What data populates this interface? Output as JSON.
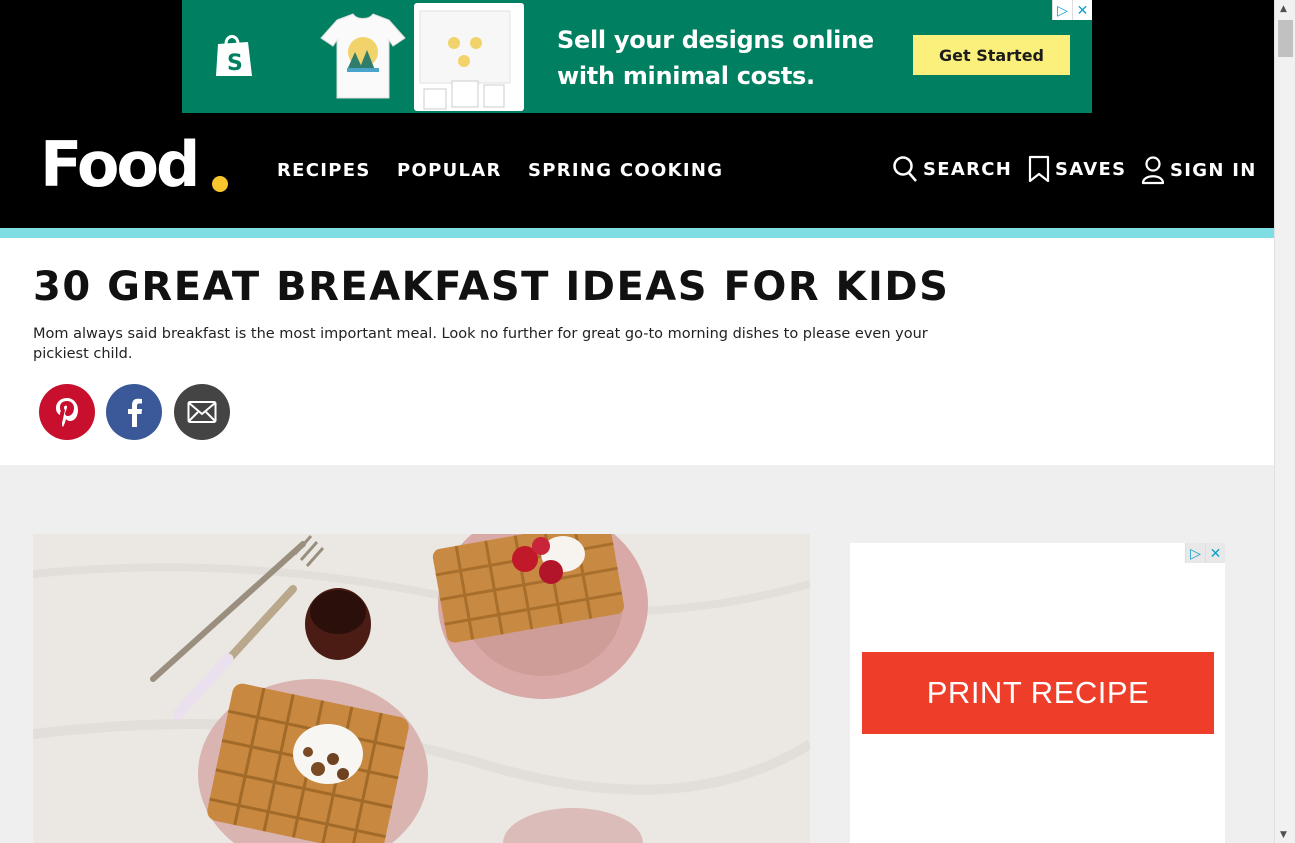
{
  "top_ad": {
    "headline_line1": "Sell your designs online",
    "headline_line2": "with minimal costs.",
    "cta": "Get Started",
    "brand_icon": "shopify-bag-icon",
    "adchoices_icon": "adchoices-icon",
    "close_icon": "close-icon",
    "colors": {
      "background": "#008060",
      "cta": "#fbf07b"
    }
  },
  "header": {
    "logo_text": "Food",
    "nav": [
      "RECIPES",
      "POPULAR",
      "SPRING COOKING"
    ],
    "search_label": "SEARCH",
    "saves_label": "SAVES",
    "signin_label": "SIGN IN",
    "colors": {
      "background": "#000000",
      "accent_dot": "#f7c62a",
      "stripe": "#7fdde4"
    }
  },
  "article": {
    "title": "30 GREAT BREAKFAST IDEAS FOR KIDS",
    "description": "Mom always said breakfast is the most important meal. Look no further for great go-to morning dishes to please even your pickiest child.",
    "share": [
      {
        "icon": "pinterest-icon",
        "color": "#c8102e"
      },
      {
        "icon": "facebook-icon",
        "color": "#3b5998"
      },
      {
        "icon": "email-icon",
        "color": "#444444"
      }
    ]
  },
  "side_ad": {
    "button_label": "PRINT RECIPE",
    "button_color": "#ee3e2a"
  }
}
